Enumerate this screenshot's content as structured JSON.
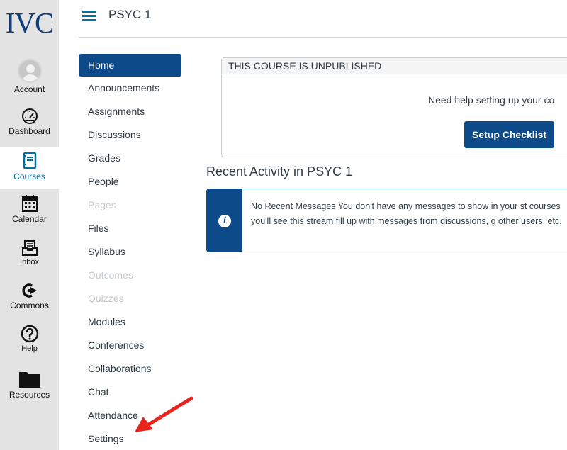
{
  "global_nav": {
    "logo": "IVC",
    "items": [
      {
        "label": "Account",
        "icon": "account-avatar-icon"
      },
      {
        "label": "Dashboard",
        "icon": "dashboard-gauge-icon"
      },
      {
        "label": "Courses",
        "icon": "courses-book-icon"
      },
      {
        "label": "Calendar",
        "icon": "calendar-icon"
      },
      {
        "label": "Inbox",
        "icon": "inbox-icon"
      },
      {
        "label": "Commons",
        "icon": "commons-icon"
      },
      {
        "label": "Help",
        "icon": "help-icon"
      },
      {
        "label": "Resources",
        "icon": "folder-icon"
      }
    ],
    "active": "Courses"
  },
  "header": {
    "course_title": "PSYC 1"
  },
  "course_nav": {
    "items": [
      {
        "label": "Home",
        "state": "active"
      },
      {
        "label": "Announcements",
        "state": "enabled"
      },
      {
        "label": "Assignments",
        "state": "enabled"
      },
      {
        "label": "Discussions",
        "state": "enabled"
      },
      {
        "label": "Grades",
        "state": "enabled"
      },
      {
        "label": "People",
        "state": "enabled"
      },
      {
        "label": "Pages",
        "state": "disabled"
      },
      {
        "label": "Files",
        "state": "enabled"
      },
      {
        "label": "Syllabus",
        "state": "enabled"
      },
      {
        "label": "Outcomes",
        "state": "disabled"
      },
      {
        "label": "Quizzes",
        "state": "disabled"
      },
      {
        "label": "Modules",
        "state": "enabled"
      },
      {
        "label": "Conferences",
        "state": "enabled"
      },
      {
        "label": "Collaborations",
        "state": "enabled"
      },
      {
        "label": "Chat",
        "state": "enabled"
      },
      {
        "label": "Attendance",
        "state": "enabled"
      },
      {
        "label": "Settings",
        "state": "enabled"
      }
    ]
  },
  "unpublished_panel": {
    "heading": "THIS COURSE IS UNPUBLISHED",
    "help_text": "Need help setting up your co",
    "button_label": "Setup Checklist"
  },
  "recent_activity": {
    "title": "Recent Activity in PSYC 1",
    "alert_text": "No Recent Messages  You don't have any messages to show in your st courses you'll see this stream fill up with messages from discussions, g other users, etc."
  },
  "colors": {
    "brand_blue": "#0d4a8a",
    "link_blue": "#0770a3",
    "logo_blue": "#0f3e7a",
    "nav_bg": "#e3e3e3",
    "arrow_red": "#e8241c"
  }
}
